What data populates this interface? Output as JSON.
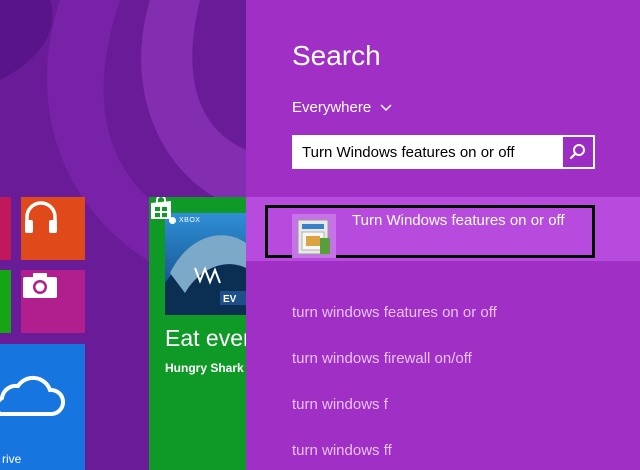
{
  "search": {
    "title": "Search",
    "scope": "Everywhere",
    "query": "Turn Windows features on or off",
    "top_result": "Turn Windows features on or off",
    "suggestions": [
      "turn windows features on or off",
      "turn windows firewall on/off",
      "turn windows f",
      "turn windows ff"
    ]
  },
  "start_screen": {
    "game_tile": {
      "badge": "XBOX",
      "title": "Eat ever",
      "subtitle": "Hungry Shark"
    },
    "onedrive_caption": "rive"
  },
  "colors": {
    "panel": "#a02fc6",
    "result_highlight": "#b64bdd",
    "start_background": "#6c1c9a"
  }
}
